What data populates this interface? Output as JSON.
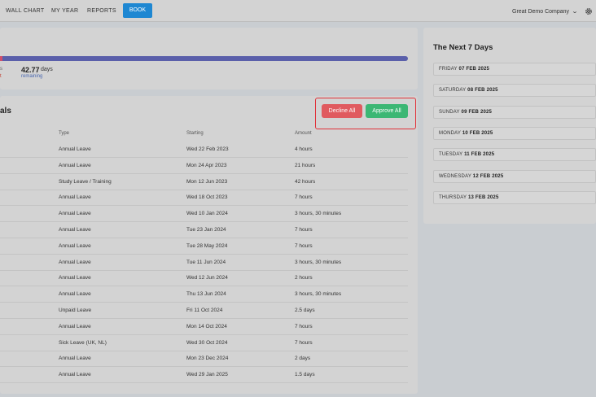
{
  "nav": {
    "items": [
      "WALL CHART",
      "MY YEAR",
      "REPORTS"
    ],
    "book_label": "BOOK",
    "company": "Great Demo Company"
  },
  "summary": {
    "remaining_value": "42.77",
    "remaining_unit": "days",
    "remaining_label": "remaining",
    "frag_top": "s",
    "frag_bottom": "t"
  },
  "approvals": {
    "title": "als",
    "decline_label": "Decline All",
    "approve_label": "Approve All",
    "columns": [
      "Type",
      "Starting",
      "Amount"
    ],
    "rows": [
      {
        "type": "Annual Leave",
        "starting": "Wed 22 Feb 2023",
        "amount": "4 hours"
      },
      {
        "type": "Annual Leave",
        "starting": "Mon 24 Apr 2023",
        "amount": "21 hours"
      },
      {
        "type": "Study Leave / Training",
        "starting": "Mon 12 Jun 2023",
        "amount": "42 hours"
      },
      {
        "type": "Annual Leave",
        "starting": "Wed 18 Oct 2023",
        "amount": "7 hours"
      },
      {
        "type": "Annual Leave",
        "starting": "Wed 10 Jan 2024",
        "amount": "3 hours, 30 minutes"
      },
      {
        "type": "Annual Leave",
        "starting": "Tue 23 Jan 2024",
        "amount": "7 hours"
      },
      {
        "type": "Annual Leave",
        "starting": "Tue 28 May 2024",
        "amount": "7 hours"
      },
      {
        "type": "Annual Leave",
        "starting": "Tue 11 Jun 2024",
        "amount": "3 hours, 30 minutes"
      },
      {
        "type": "Annual Leave",
        "starting": "Wed 12 Jun 2024",
        "amount": "2 hours"
      },
      {
        "type": "Annual Leave",
        "starting": "Thu 13 Jun 2024",
        "amount": "3 hours, 30 minutes"
      },
      {
        "type": "Unpaid Leave",
        "starting": "Fri 11 Oct 2024",
        "amount": "2.5 days"
      },
      {
        "type": "Annual Leave",
        "starting": "Mon 14 Oct 2024",
        "amount": "7 hours"
      },
      {
        "type": "Sick Leave (UK, NL)",
        "starting": "Wed 30 Oct 2024",
        "amount": "7 hours"
      },
      {
        "type": "Annual Leave",
        "starting": "Mon 23 Dec 2024",
        "amount": "2 days"
      },
      {
        "type": "Annual Leave",
        "starting": "Wed 29 Jan 2025",
        "amount": "1.5 days"
      }
    ]
  },
  "next7": {
    "title": "The Next 7 Days",
    "days": [
      {
        "weekday": "FRIDAY",
        "date": "07 FEB 2025"
      },
      {
        "weekday": "SATURDAY",
        "date": "08 FEB 2025"
      },
      {
        "weekday": "SUNDAY",
        "date": "09 FEB 2025"
      },
      {
        "weekday": "MONDAY",
        "date": "10 FEB 2025"
      },
      {
        "weekday": "TUESDAY",
        "date": "11 FEB 2025"
      },
      {
        "weekday": "WEDNESDAY",
        "date": "12 FEB 2025"
      },
      {
        "weekday": "THURSDAY",
        "date": "13 FEB 2025"
      }
    ]
  },
  "colors": {
    "book": "#1e87d2",
    "decline": "#e05a5f",
    "approve": "#3cb774",
    "progress": "#5a5faa",
    "highlight": "#e0323a"
  }
}
